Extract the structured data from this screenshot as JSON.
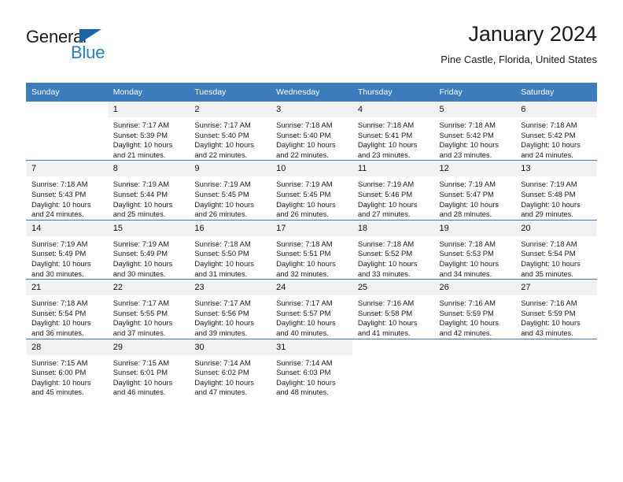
{
  "brand": {
    "name_part1": "General",
    "name_part2": "Blue",
    "triangle_icon": "triangle-icon",
    "color_dark": "#1a1a1a",
    "color_blue": "#1f7fd0"
  },
  "header": {
    "title": "January 2024",
    "subtitle": "Pine Castle, Florida, United States"
  },
  "theme": {
    "header_bg": "#3a7cbd",
    "header_text": "#ffffff",
    "daynum_bg": "#f2f2f2",
    "grid_line": "#3a7cbd",
    "page_bg": "#ffffff"
  },
  "weekdays": [
    "Sunday",
    "Monday",
    "Tuesday",
    "Wednesday",
    "Thursday",
    "Friday",
    "Saturday"
  ],
  "weeks": [
    [
      {
        "day": "",
        "sunrise": "",
        "sunset": "",
        "daylight1": "",
        "daylight2": ""
      },
      {
        "day": "1",
        "sunrise": "Sunrise: 7:17 AM",
        "sunset": "Sunset: 5:39 PM",
        "daylight1": "Daylight: 10 hours",
        "daylight2": "and 21 minutes."
      },
      {
        "day": "2",
        "sunrise": "Sunrise: 7:17 AM",
        "sunset": "Sunset: 5:40 PM",
        "daylight1": "Daylight: 10 hours",
        "daylight2": "and 22 minutes."
      },
      {
        "day": "3",
        "sunrise": "Sunrise: 7:18 AM",
        "sunset": "Sunset: 5:40 PM",
        "daylight1": "Daylight: 10 hours",
        "daylight2": "and 22 minutes."
      },
      {
        "day": "4",
        "sunrise": "Sunrise: 7:18 AM",
        "sunset": "Sunset: 5:41 PM",
        "daylight1": "Daylight: 10 hours",
        "daylight2": "and 23 minutes."
      },
      {
        "day": "5",
        "sunrise": "Sunrise: 7:18 AM",
        "sunset": "Sunset: 5:42 PM",
        "daylight1": "Daylight: 10 hours",
        "daylight2": "and 23 minutes."
      },
      {
        "day": "6",
        "sunrise": "Sunrise: 7:18 AM",
        "sunset": "Sunset: 5:42 PM",
        "daylight1": "Daylight: 10 hours",
        "daylight2": "and 24 minutes."
      }
    ],
    [
      {
        "day": "7",
        "sunrise": "Sunrise: 7:18 AM",
        "sunset": "Sunset: 5:43 PM",
        "daylight1": "Daylight: 10 hours",
        "daylight2": "and 24 minutes."
      },
      {
        "day": "8",
        "sunrise": "Sunrise: 7:19 AM",
        "sunset": "Sunset: 5:44 PM",
        "daylight1": "Daylight: 10 hours",
        "daylight2": "and 25 minutes."
      },
      {
        "day": "9",
        "sunrise": "Sunrise: 7:19 AM",
        "sunset": "Sunset: 5:45 PM",
        "daylight1": "Daylight: 10 hours",
        "daylight2": "and 26 minutes."
      },
      {
        "day": "10",
        "sunrise": "Sunrise: 7:19 AM",
        "sunset": "Sunset: 5:45 PM",
        "daylight1": "Daylight: 10 hours",
        "daylight2": "and 26 minutes."
      },
      {
        "day": "11",
        "sunrise": "Sunrise: 7:19 AM",
        "sunset": "Sunset: 5:46 PM",
        "daylight1": "Daylight: 10 hours",
        "daylight2": "and 27 minutes."
      },
      {
        "day": "12",
        "sunrise": "Sunrise: 7:19 AM",
        "sunset": "Sunset: 5:47 PM",
        "daylight1": "Daylight: 10 hours",
        "daylight2": "and 28 minutes."
      },
      {
        "day": "13",
        "sunrise": "Sunrise: 7:19 AM",
        "sunset": "Sunset: 5:48 PM",
        "daylight1": "Daylight: 10 hours",
        "daylight2": "and 29 minutes."
      }
    ],
    [
      {
        "day": "14",
        "sunrise": "Sunrise: 7:19 AM",
        "sunset": "Sunset: 5:49 PM",
        "daylight1": "Daylight: 10 hours",
        "daylight2": "and 30 minutes."
      },
      {
        "day": "15",
        "sunrise": "Sunrise: 7:19 AM",
        "sunset": "Sunset: 5:49 PM",
        "daylight1": "Daylight: 10 hours",
        "daylight2": "and 30 minutes."
      },
      {
        "day": "16",
        "sunrise": "Sunrise: 7:18 AM",
        "sunset": "Sunset: 5:50 PM",
        "daylight1": "Daylight: 10 hours",
        "daylight2": "and 31 minutes."
      },
      {
        "day": "17",
        "sunrise": "Sunrise: 7:18 AM",
        "sunset": "Sunset: 5:51 PM",
        "daylight1": "Daylight: 10 hours",
        "daylight2": "and 32 minutes."
      },
      {
        "day": "18",
        "sunrise": "Sunrise: 7:18 AM",
        "sunset": "Sunset: 5:52 PM",
        "daylight1": "Daylight: 10 hours",
        "daylight2": "and 33 minutes."
      },
      {
        "day": "19",
        "sunrise": "Sunrise: 7:18 AM",
        "sunset": "Sunset: 5:53 PM",
        "daylight1": "Daylight: 10 hours",
        "daylight2": "and 34 minutes."
      },
      {
        "day": "20",
        "sunrise": "Sunrise: 7:18 AM",
        "sunset": "Sunset: 5:54 PM",
        "daylight1": "Daylight: 10 hours",
        "daylight2": "and 35 minutes."
      }
    ],
    [
      {
        "day": "21",
        "sunrise": "Sunrise: 7:18 AM",
        "sunset": "Sunset: 5:54 PM",
        "daylight1": "Daylight: 10 hours",
        "daylight2": "and 36 minutes."
      },
      {
        "day": "22",
        "sunrise": "Sunrise: 7:17 AM",
        "sunset": "Sunset: 5:55 PM",
        "daylight1": "Daylight: 10 hours",
        "daylight2": "and 37 minutes."
      },
      {
        "day": "23",
        "sunrise": "Sunrise: 7:17 AM",
        "sunset": "Sunset: 5:56 PM",
        "daylight1": "Daylight: 10 hours",
        "daylight2": "and 39 minutes."
      },
      {
        "day": "24",
        "sunrise": "Sunrise: 7:17 AM",
        "sunset": "Sunset: 5:57 PM",
        "daylight1": "Daylight: 10 hours",
        "daylight2": "and 40 minutes."
      },
      {
        "day": "25",
        "sunrise": "Sunrise: 7:16 AM",
        "sunset": "Sunset: 5:58 PM",
        "daylight1": "Daylight: 10 hours",
        "daylight2": "and 41 minutes."
      },
      {
        "day": "26",
        "sunrise": "Sunrise: 7:16 AM",
        "sunset": "Sunset: 5:59 PM",
        "daylight1": "Daylight: 10 hours",
        "daylight2": "and 42 minutes."
      },
      {
        "day": "27",
        "sunrise": "Sunrise: 7:16 AM",
        "sunset": "Sunset: 5:59 PM",
        "daylight1": "Daylight: 10 hours",
        "daylight2": "and 43 minutes."
      }
    ],
    [
      {
        "day": "28",
        "sunrise": "Sunrise: 7:15 AM",
        "sunset": "Sunset: 6:00 PM",
        "daylight1": "Daylight: 10 hours",
        "daylight2": "and 45 minutes."
      },
      {
        "day": "29",
        "sunrise": "Sunrise: 7:15 AM",
        "sunset": "Sunset: 6:01 PM",
        "daylight1": "Daylight: 10 hours",
        "daylight2": "and 46 minutes."
      },
      {
        "day": "30",
        "sunrise": "Sunrise: 7:14 AM",
        "sunset": "Sunset: 6:02 PM",
        "daylight1": "Daylight: 10 hours",
        "daylight2": "and 47 minutes."
      },
      {
        "day": "31",
        "sunrise": "Sunrise: 7:14 AM",
        "sunset": "Sunset: 6:03 PM",
        "daylight1": "Daylight: 10 hours",
        "daylight2": "and 48 minutes."
      },
      {
        "day": "",
        "sunrise": "",
        "sunset": "",
        "daylight1": "",
        "daylight2": ""
      },
      {
        "day": "",
        "sunrise": "",
        "sunset": "",
        "daylight1": "",
        "daylight2": ""
      },
      {
        "day": "",
        "sunrise": "",
        "sunset": "",
        "daylight1": "",
        "daylight2": ""
      }
    ]
  ]
}
